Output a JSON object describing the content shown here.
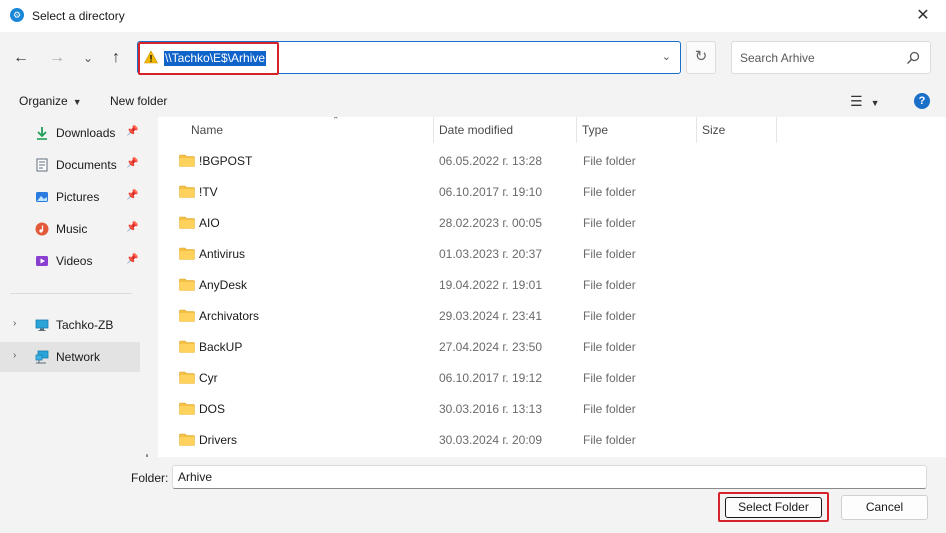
{
  "window": {
    "title": "Select a directory",
    "close_glyph": "✕"
  },
  "nav": {
    "back_glyph": "←",
    "forward_glyph": "→",
    "recent_glyph": "⌄",
    "up_glyph": "↑",
    "address": "\\\\Tachko\\E$\\Arhive",
    "address_icon": "warning-icon",
    "refresh_glyph": "↻",
    "search_placeholder": "Search Arhive"
  },
  "toolbar": {
    "organize_label": "Organize",
    "new_folder_label": "New folder",
    "view_glyph": "☰",
    "help_glyph": "?"
  },
  "sidebar": {
    "quick_access": [
      {
        "label": "Downloads",
        "icon": "download-icon",
        "pinned": true
      },
      {
        "label": "Documents",
        "icon": "documents-icon",
        "pinned": true
      },
      {
        "label": "Pictures",
        "icon": "pictures-icon",
        "pinned": true
      },
      {
        "label": "Music",
        "icon": "music-icon",
        "pinned": true
      },
      {
        "label": "Videos",
        "icon": "videos-icon",
        "pinned": true
      }
    ],
    "locations": [
      {
        "label": "Tachko-ZB",
        "icon": "computer-icon",
        "selected": false
      },
      {
        "label": "Network",
        "icon": "network-icon",
        "selected": true
      }
    ]
  },
  "columns": {
    "name": "Name",
    "date": "Date modified",
    "type": "Type",
    "size": "Size"
  },
  "files": [
    {
      "name": "!BGPOST",
      "date": "06.05.2022 г. 13:28",
      "type": "File folder"
    },
    {
      "name": "!TV",
      "date": "06.10.2017 г. 19:10",
      "type": "File folder"
    },
    {
      "name": "AIO",
      "date": "28.02.2023 г. 00:05",
      "type": "File folder"
    },
    {
      "name": "Antivirus",
      "date": "01.03.2023 г. 20:37",
      "type": "File folder"
    },
    {
      "name": "AnyDesk",
      "date": "19.04.2022 г. 19:01",
      "type": "File folder"
    },
    {
      "name": "Archivators",
      "date": "29.03.2024 г. 23:41",
      "type": "File folder"
    },
    {
      "name": "BackUP",
      "date": "27.04.2024 г. 23:50",
      "type": "File folder"
    },
    {
      "name": "Cyr",
      "date": "06.10.2017 г. 19:12",
      "type": "File folder"
    },
    {
      "name": "DOS",
      "date": "30.03.2016 г. 13:13",
      "type": "File folder"
    },
    {
      "name": "Drivers",
      "date": "30.03.2024 г. 20:09",
      "type": "File folder"
    }
  ],
  "footer": {
    "folder_label": "Folder:",
    "folder_value": "Arhive",
    "select_label": "Select Folder",
    "cancel_label": "Cancel"
  },
  "colors": {
    "accent": "#1a6fc9",
    "selection": "#0f63c9",
    "highlight_box": "#d6232b",
    "folder": "#f4c144"
  }
}
